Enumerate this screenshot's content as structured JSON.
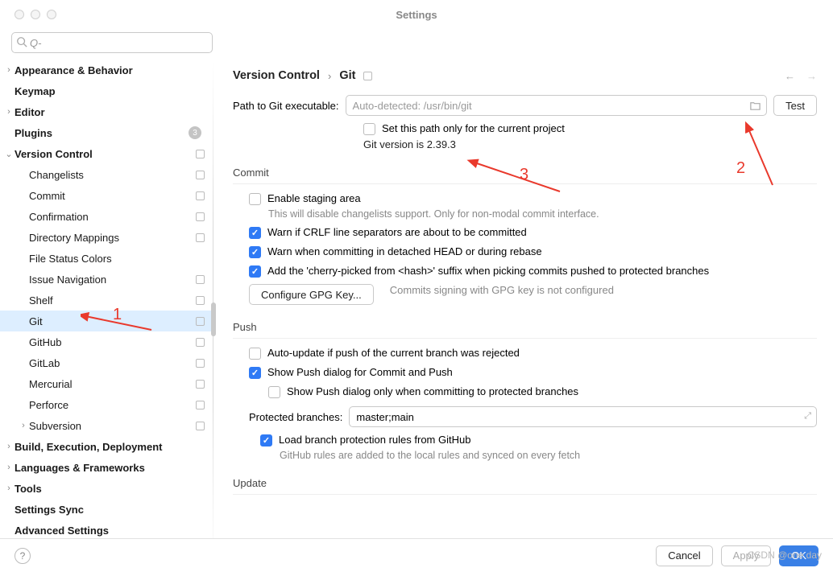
{
  "window": {
    "title": "Settings"
  },
  "breadcrumb": {
    "root": "Version Control",
    "leaf": "Git"
  },
  "nav": {
    "back": "←",
    "fwd": "→"
  },
  "search": {
    "placeholder": ""
  },
  "sidebar": {
    "items": [
      {
        "label": "Appearance & Behavior",
        "bold": true,
        "chev": true,
        "indent": 1
      },
      {
        "label": "Keymap",
        "bold": true,
        "indent": 1
      },
      {
        "label": "Editor",
        "bold": true,
        "chev": true,
        "indent": 1
      },
      {
        "label": "Plugins",
        "bold": true,
        "badge": "3",
        "indent": 1
      },
      {
        "label": "Version Control",
        "bold": true,
        "expanded": true,
        "sq": true,
        "indent": 1
      },
      {
        "label": "Changelists",
        "sq": true,
        "indent": 2
      },
      {
        "label": "Commit",
        "sq": true,
        "indent": 2
      },
      {
        "label": "Confirmation",
        "sq": true,
        "indent": 2
      },
      {
        "label": "Directory Mappings",
        "sq": true,
        "indent": 2
      },
      {
        "label": "File Status Colors",
        "indent": 2
      },
      {
        "label": "Issue Navigation",
        "sq": true,
        "indent": 2
      },
      {
        "label": "Shelf",
        "sq": true,
        "indent": 2
      },
      {
        "label": "Git",
        "selected": true,
        "sq": true,
        "indent": 2
      },
      {
        "label": "GitHub",
        "sq": true,
        "indent": 2
      },
      {
        "label": "GitLab",
        "sq": true,
        "indent": 2
      },
      {
        "label": "Mercurial",
        "sq": true,
        "indent": 2
      },
      {
        "label": "Perforce",
        "sq": true,
        "indent": 2
      },
      {
        "label": "Subversion",
        "chev": true,
        "sq": true,
        "indent": 2
      },
      {
        "label": "Build, Execution, Deployment",
        "bold": true,
        "chev": true,
        "indent": 1
      },
      {
        "label": "Languages & Frameworks",
        "bold": true,
        "chev": true,
        "indent": 1
      },
      {
        "label": "Tools",
        "bold": true,
        "chev": true,
        "indent": 1
      },
      {
        "label": "Settings Sync",
        "bold": true,
        "indent": 1
      },
      {
        "label": "Advanced Settings",
        "bold": true,
        "indent": 1
      }
    ]
  },
  "git": {
    "path_label": "Path to Git executable:",
    "path_placeholder": "Auto-detected: /usr/bin/git",
    "test_btn": "Test",
    "set_path_current": "Set this path only for the current project",
    "version": "Git version is 2.39.3",
    "sections": {
      "commit": "Commit",
      "push": "Push",
      "update": "Update"
    },
    "commit": {
      "enable_staging": "Enable staging area",
      "enable_staging_hint": "This will disable changelists support. Only for non-modal commit interface.",
      "warn_crlf": "Warn if CRLF line separators are about to be committed",
      "warn_detached": "Warn when committing in detached HEAD or during rebase",
      "cherry_pick": "Add the 'cherry-picked from <hash>' suffix when picking commits pushed to protected branches",
      "gpg_btn": "Configure GPG Key...",
      "gpg_hint": "Commits signing with GPG key is not configured"
    },
    "push": {
      "auto_update": "Auto-update if push of the current branch was rejected",
      "show_dialog": "Show Push dialog for Commit and Push",
      "show_dialog_protected": "Show Push dialog only when committing to protected branches",
      "protected_label": "Protected branches:",
      "protected_value": "master;main",
      "load_gh": "Load branch protection rules from GitHub",
      "load_gh_hint": "GitHub rules are added to the local rules and synced on every fetch"
    }
  },
  "footer": {
    "cancel": "Cancel",
    "apply": "Apply",
    "ok": "OK"
  },
  "annotations": {
    "a1": "1",
    "a2": "2",
    "a3": "3"
  },
  "watermark": "CSDN @one day"
}
